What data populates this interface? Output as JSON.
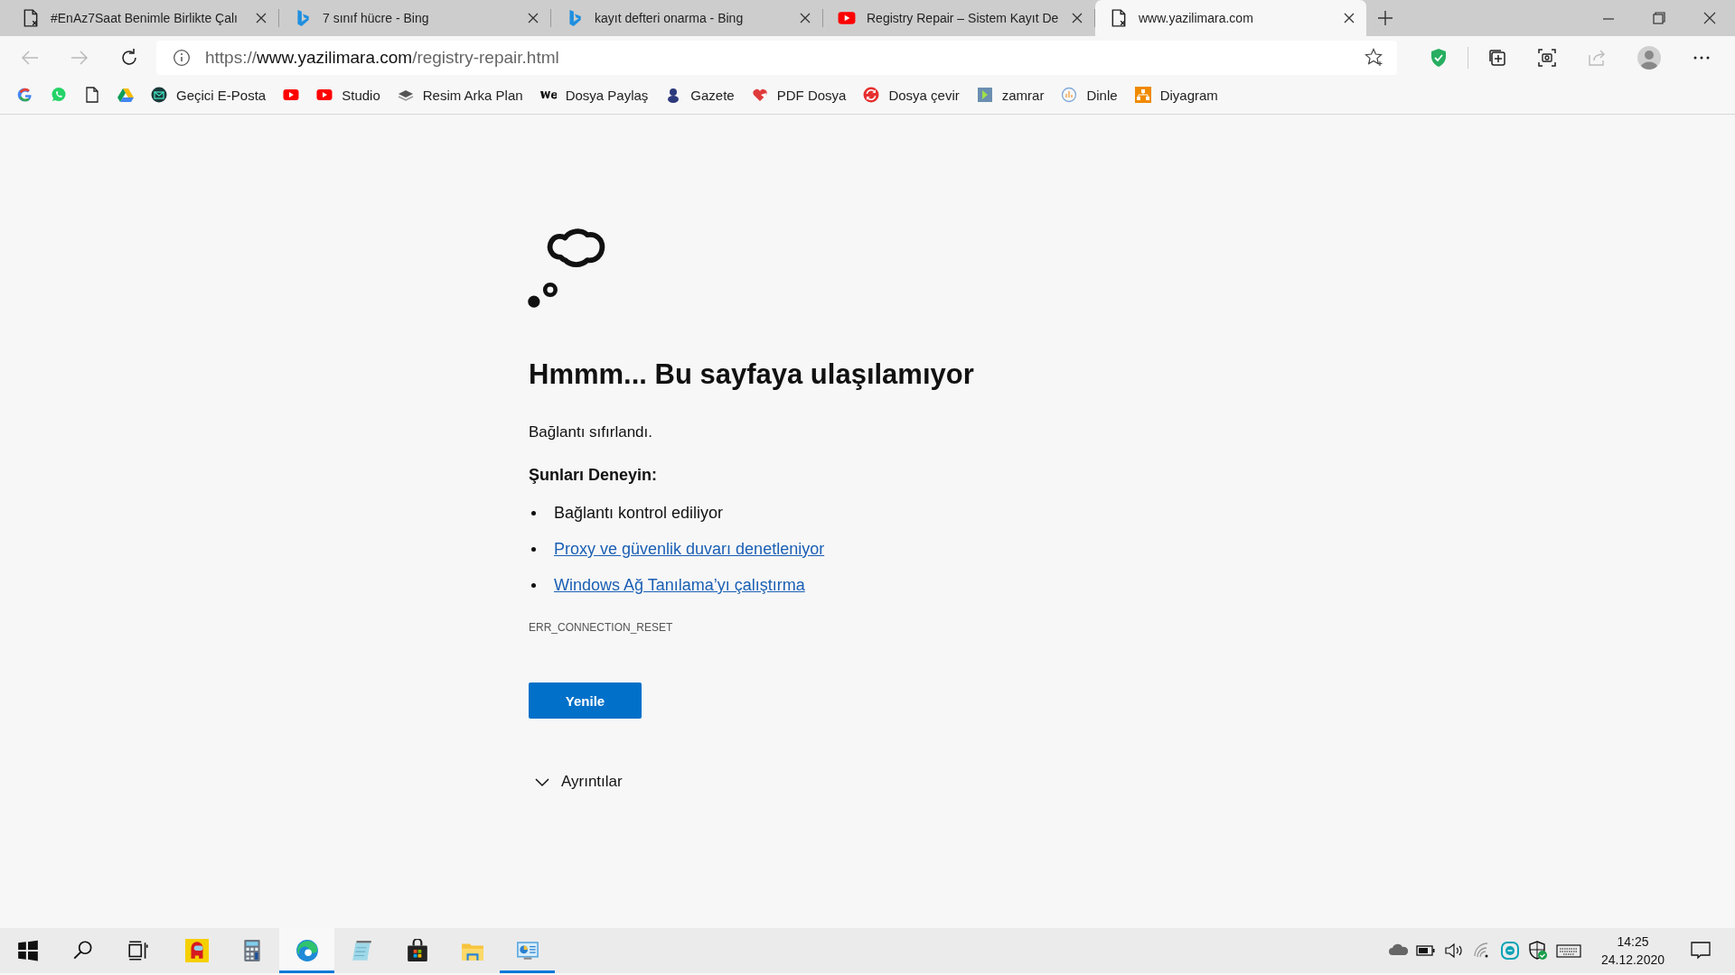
{
  "tabs": [
    {
      "title": "#EnAz7Saat Benimle Birlikte Çalı",
      "selected": false
    },
    {
      "title": "7 sınıf hücre - Bing",
      "selected": false
    },
    {
      "title": "kayıt defteri onarma - Bing",
      "selected": false
    },
    {
      "title": "Registry Repair – Sistem Kayıt De",
      "selected": false
    },
    {
      "title": "www.yazilimara.com",
      "selected": true
    }
  ],
  "toolbar": {
    "back": {
      "disabled": true
    },
    "forward": {
      "disabled": true
    },
    "share": {
      "disabled": true
    }
  },
  "address": {
    "scheme": "https://",
    "host": "www.yazilimara.com",
    "path": "/registry-repair.html"
  },
  "bookmarks": [
    {
      "kind": "icon"
    },
    {
      "kind": "icon"
    },
    {
      "kind": "icon"
    },
    {
      "kind": "icon"
    },
    {
      "kind": "link",
      "label": "Geçici E-Posta"
    },
    {
      "kind": "icon"
    },
    {
      "kind": "link",
      "label": "Studio"
    },
    {
      "kind": "link",
      "label": "Resim Arka Plan"
    },
    {
      "kind": "link",
      "label": "Dosya Paylaş"
    },
    {
      "kind": "link",
      "label": "Gazete"
    },
    {
      "kind": "link",
      "label": "PDF Dosya"
    },
    {
      "kind": "link",
      "label": "Dosya çevir"
    },
    {
      "kind": "link",
      "label": "zamrar"
    },
    {
      "kind": "link",
      "label": "Dinle"
    },
    {
      "kind": "link",
      "label": "Diyagram"
    }
  ],
  "page": {
    "heading": "Hmmm... Bu sayfaya ulaşılamıyor",
    "message": "Bağlantı sıfırlandı.",
    "try_heading": "Şunları Deneyin:",
    "suggestions": [
      {
        "kind": "text",
        "text": "Bağlantı kontrol ediliyor"
      },
      {
        "kind": "link",
        "text": "Proxy ve güvenlik duvarı denetleniyor"
      },
      {
        "kind": "link",
        "text": "Windows Ağ Tanılama’yı çalıştırma"
      }
    ],
    "error_code": "ERR_CONNECTION_RESET",
    "button": "Yenile",
    "details": {
      "label": "Ayrıntılar",
      "expanded": false
    }
  },
  "taskbar": {
    "apps": [
      {
        "running": false,
        "selected": false
      },
      {
        "running": false,
        "selected": false
      },
      {
        "running": false,
        "selected": false
      },
      {
        "running": false,
        "selected": false
      },
      {
        "running": false,
        "selected": false
      },
      {
        "running": true,
        "selected": true
      },
      {
        "running": false,
        "selected": false
      },
      {
        "running": false,
        "selected": false
      },
      {
        "running": false,
        "selected": false
      },
      {
        "running": true,
        "selected": false
      }
    ],
    "time": "14:25",
    "date": "24.12.2020"
  }
}
